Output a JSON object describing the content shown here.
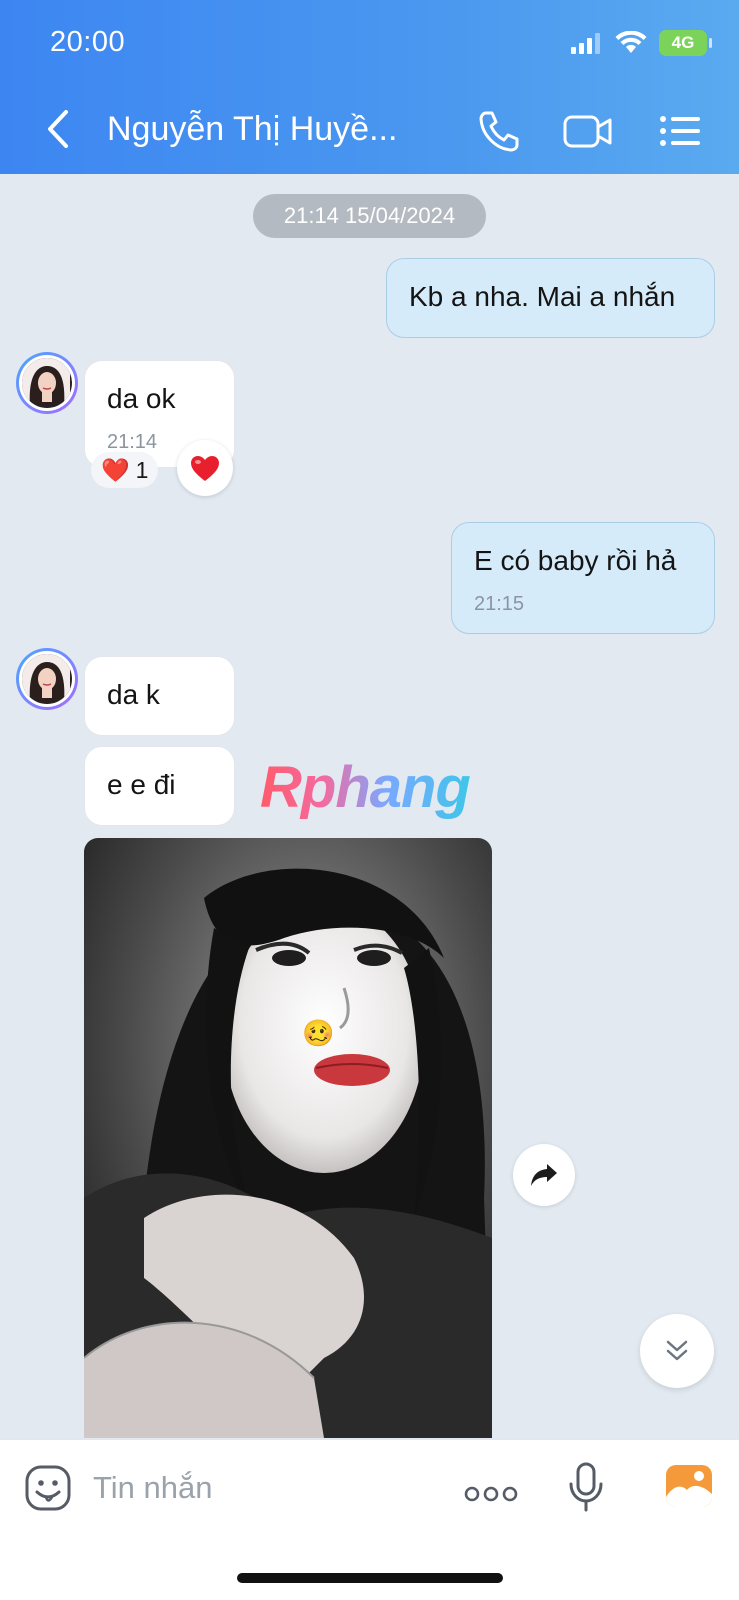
{
  "status_bar": {
    "time": "20:00",
    "network": "4G"
  },
  "header": {
    "contact_name": "Nguyễn Thị Huyề...",
    "icons": [
      "back-icon",
      "phone-icon",
      "video-icon",
      "menu-list-icon"
    ]
  },
  "chat": {
    "date_separator": "21:14 15/04/2024",
    "messages": [
      {
        "sender": "me",
        "text": "Kb a nha. Mai a nhắn"
      },
      {
        "sender": "contact",
        "text": "da ok",
        "time": "21:14",
        "reaction": "❤️",
        "reaction_count": "1"
      },
      {
        "sender": "me",
        "text": "E có baby rồi hả",
        "time": "21:15"
      },
      {
        "sender": "contact",
        "text": "da k"
      },
      {
        "sender": "contact",
        "text": "e e đi"
      },
      {
        "sender": "contact",
        "type": "photo",
        "sticker": "🥴"
      }
    ],
    "watermark": "Rphang"
  },
  "composer": {
    "placeholder": "Tin nhắn",
    "icons": [
      "sticker-icon",
      "more-icon",
      "mic-icon",
      "gallery-icon"
    ]
  },
  "colors": {
    "header_start": "#3d86f2",
    "header_end": "#5aaaf0",
    "chat_background": "#e2e9f1",
    "outgoing_bubble": "#d6ebfa",
    "incoming_bubble": "#ffffff",
    "gallery_icon": "#f59a3a"
  }
}
